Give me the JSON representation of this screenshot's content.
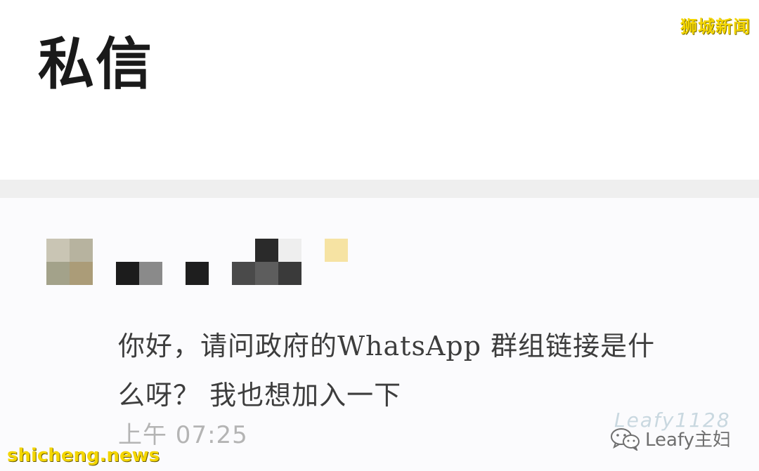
{
  "header": {
    "title": "私信"
  },
  "watermarks": {
    "top_right": "狮城新闻",
    "bottom_left": "shicheng.news",
    "faint": "Leafy1128",
    "credit": "Leafy主妇"
  },
  "message": {
    "text_line1": "你好，请问政府的WhatsApp 群组链接是什",
    "text_line2": "么呀？ 我也想加入一下",
    "time": "上午 07:25"
  },
  "icons": {
    "avatar": "pixelated-avatar-icon",
    "name": "pixelated-username",
    "wechat": "wechat-icon"
  },
  "colors": {
    "watermark_yellow": "#f4d600",
    "divider": "#efefef",
    "message_text": "#3d3d3d",
    "timestamp": "#b4b4b4"
  }
}
